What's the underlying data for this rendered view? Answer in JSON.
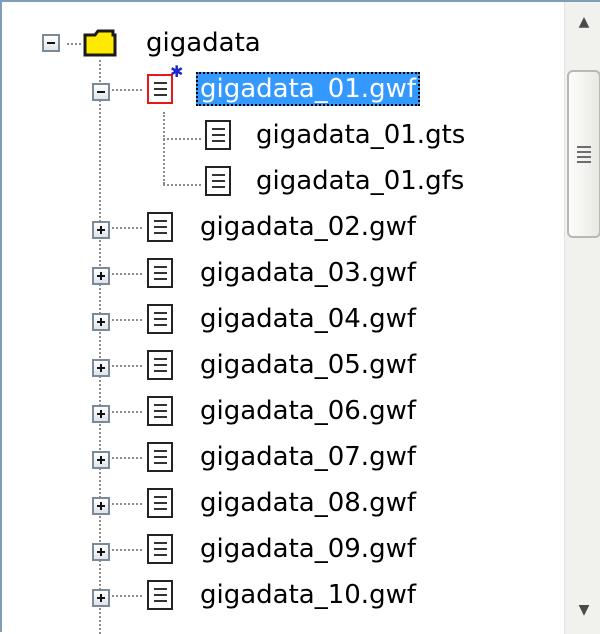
{
  "tree": {
    "root": {
      "label": "gigadata",
      "icon": "folder-icon",
      "expanded": true
    },
    "items": [
      {
        "label": "gigadata_01.gwf",
        "expanded": true,
        "selected": true,
        "children": [
          {
            "label": "gigadata_01.gts"
          },
          {
            "label": "gigadata_01.gfs"
          }
        ]
      },
      {
        "label": "gigadata_02.gwf",
        "expanded": false
      },
      {
        "label": "gigadata_03.gwf",
        "expanded": false
      },
      {
        "label": "gigadata_04.gwf",
        "expanded": false
      },
      {
        "label": "gigadata_05.gwf",
        "expanded": false
      },
      {
        "label": "gigadata_06.gwf",
        "expanded": false
      },
      {
        "label": "gigadata_07.gwf",
        "expanded": false
      },
      {
        "label": "gigadata_08.gwf",
        "expanded": false
      },
      {
        "label": "gigadata_09.gwf",
        "expanded": false
      },
      {
        "label": "gigadata_10.gwf",
        "expanded": false
      }
    ]
  },
  "scrollbar": {
    "up_arrow": "▲",
    "down_arrow": "▼",
    "position": 0
  },
  "colors": {
    "selection": "#3399ff",
    "folder": "#ffe900",
    "selected_icon_border": "#e81818",
    "tree_lines": "#8c8c8c"
  }
}
